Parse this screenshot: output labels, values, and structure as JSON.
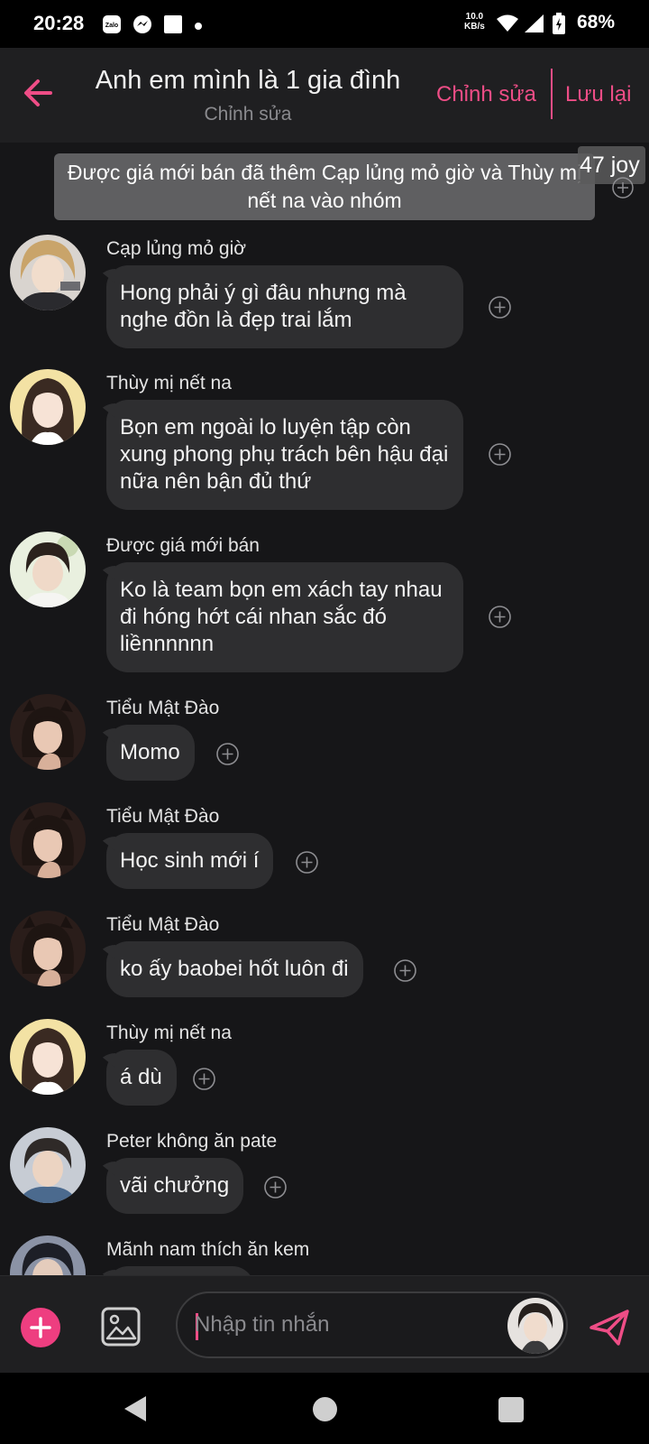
{
  "status_bar": {
    "time": "20:28",
    "notif_icons": [
      "zalo-icon",
      "messenger-icon",
      "square-icon",
      "dot-icon"
    ],
    "net_speed_value": "10.0",
    "net_speed_unit": "KB/s",
    "battery": "68%"
  },
  "header": {
    "title": "Anh em mình là 1 gia đình",
    "subtitle": "Chỉnh sửa",
    "edit_label": "Chỉnh sửa",
    "save_label": "Lưu lại"
  },
  "chat": {
    "system_notice": "Được giá mới bán đã thêm Cạp lủng mỏ giờ và Thùy mị nết na vào nhóm",
    "joy_badge": "47 joy",
    "messages": [
      {
        "sender": "Cạp lủng mỏ giờ",
        "text": "Hong phải ý gì đâu nhưng mà nghe đồn là đẹp trai lắm"
      },
      {
        "sender": "Thùy mị nết na",
        "text": "Bọn em ngoài lo luyện tập còn xung phong phụ trách bên hậu đại nữa nên bận đủ thứ"
      },
      {
        "sender": "Được giá mới bán",
        "text": "Ko là team bọn em xách tay nhau đi hóng hớt cái nhan sắc đó liềnnnnnn"
      },
      {
        "sender": "Tiểu Mật Đào",
        "text": "Momo"
      },
      {
        "sender": "Tiểu Mật Đào",
        "text": "Học sinh mới í"
      },
      {
        "sender": "Tiểu Mật Đào",
        "text": "ko ấy baobei hốt luôn đi"
      },
      {
        "sender": "Thùy mị nết na",
        "text": "á dù"
      },
      {
        "sender": "Peter không ăn pate",
        "text": "vãi chưởng"
      },
      {
        "sender": "Mãnh nam thích ăn kem",
        "text": ""
      }
    ]
  },
  "input": {
    "placeholder": "Nhập tin nhắn"
  },
  "colors": {
    "accent": "#ee4d86",
    "background": "#161618",
    "header": "#1f1f21",
    "bubble": "#2e2e30",
    "system_notice": "#5f5f61"
  }
}
